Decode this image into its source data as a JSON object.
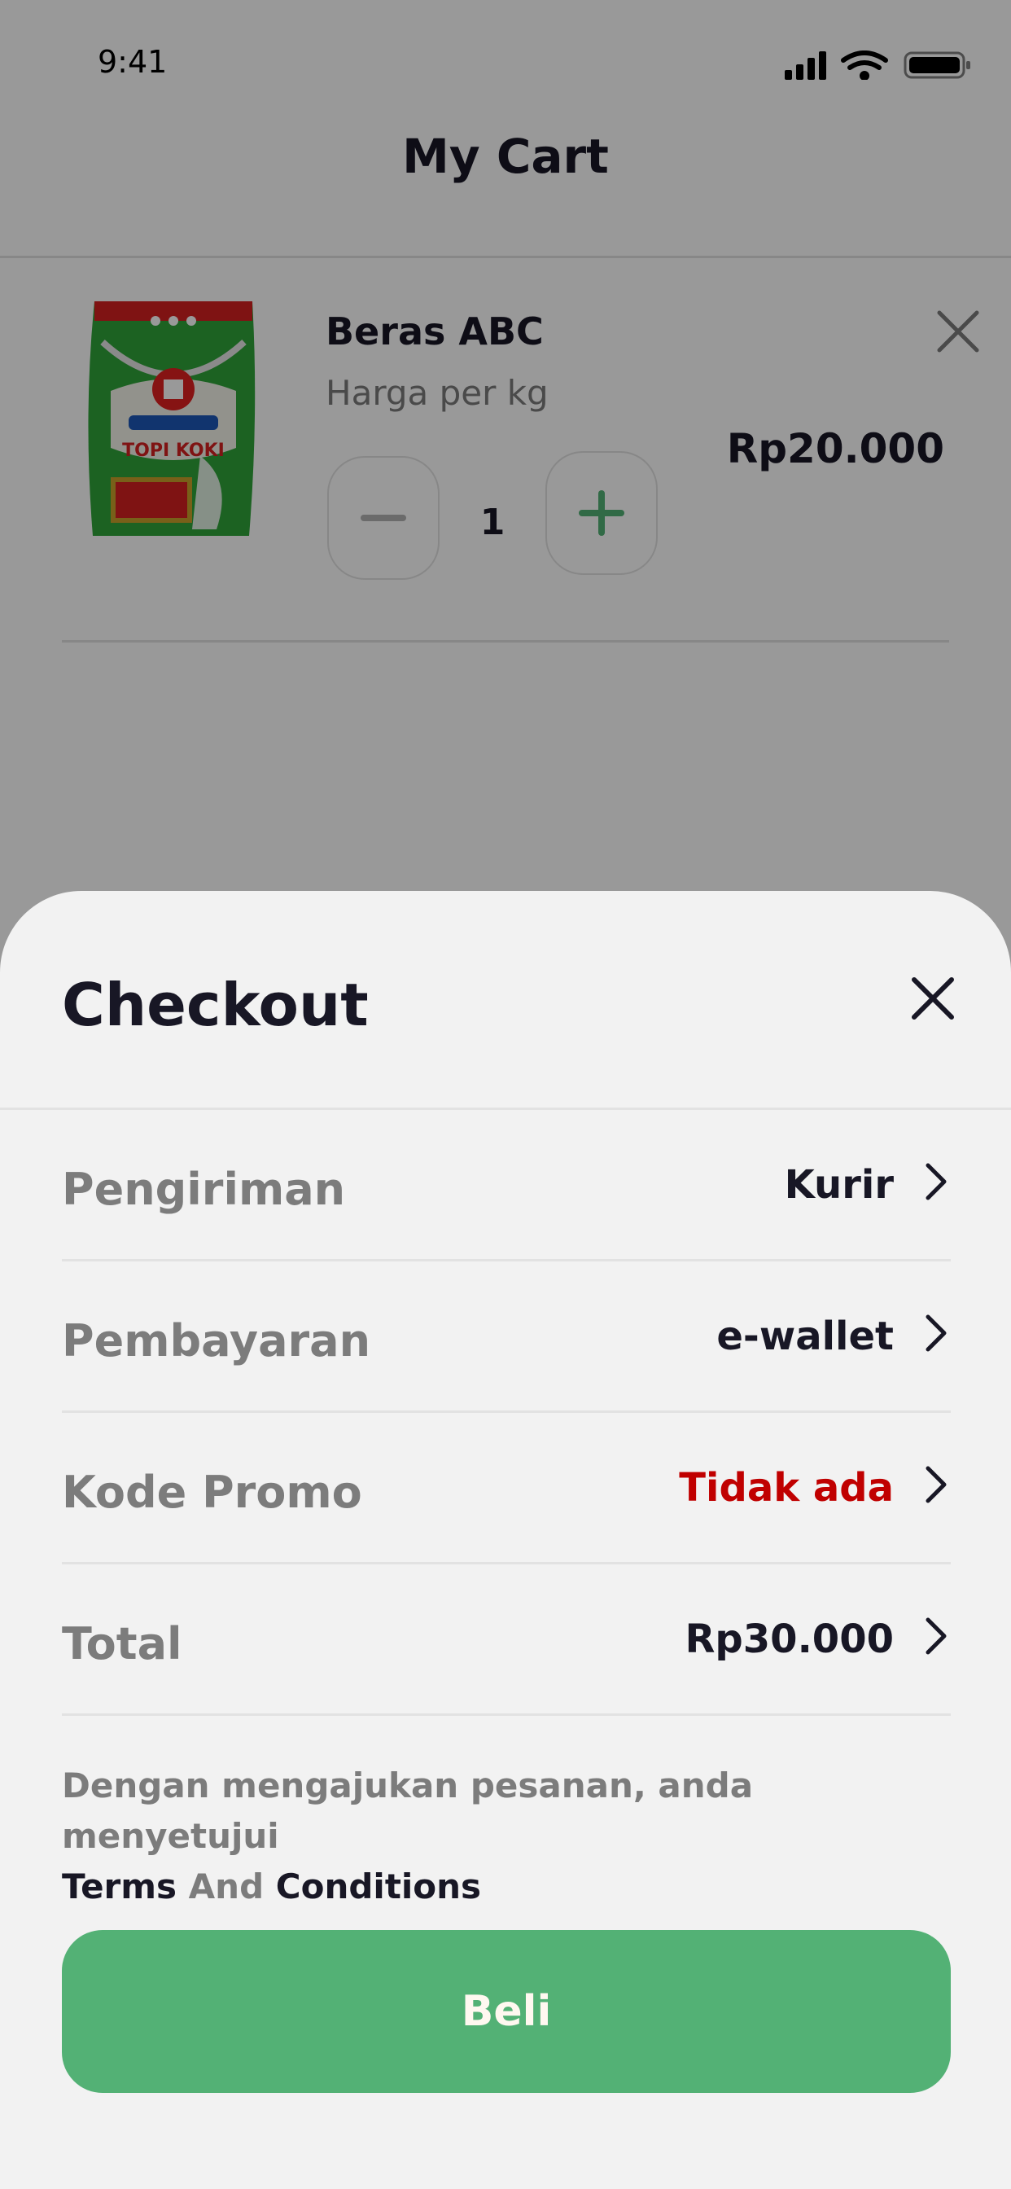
{
  "status_bar": {
    "time": "9:41"
  },
  "header": {
    "title": "My Cart"
  },
  "cart": {
    "item": {
      "name": "Beras ABC",
      "unit": "Harga per kg",
      "quantity": "1",
      "price": "Rp20.000",
      "image_label": "TOPI KOKI"
    }
  },
  "checkout": {
    "title": "Checkout",
    "rows": [
      {
        "label": "Pengiriman",
        "value": "Kurir"
      },
      {
        "label": "Pembayaran",
        "value": "e-wallet"
      },
      {
        "label": "Kode Promo",
        "value": "Tidak ada"
      },
      {
        "label": "Total",
        "value": "Rp30.000"
      }
    ],
    "terms": {
      "prefix": "Dengan mengajukan pesanan, anda menyetujui",
      "terms_link": "Terms",
      "and": "And",
      "conditions_link": "Conditions"
    },
    "buy_label": "Beli"
  },
  "colors": {
    "accent": "#53B175",
    "promo": "#C00000",
    "text": "#181725",
    "muted": "#7C7C7C"
  }
}
